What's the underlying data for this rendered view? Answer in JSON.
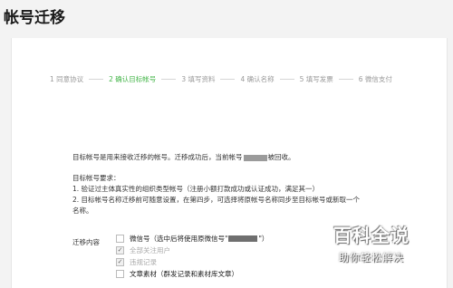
{
  "page_title": "帐号迁移",
  "steps": [
    {
      "label": "1 同意协议",
      "active": false
    },
    {
      "label": "2 确认目标帐号",
      "active": true
    },
    {
      "label": "3 填写资料",
      "active": false
    },
    {
      "label": "4 确认名称",
      "active": false
    },
    {
      "label": "5 填写发票",
      "active": false
    },
    {
      "label": "6 微信支付",
      "active": false
    }
  ],
  "intro": {
    "part1": "目标帐号是用来接收迁移的帐号。迁移成功后，当前帐号",
    "part2": "被回收。"
  },
  "requirements": {
    "title": "目标帐号要求：",
    "item1": "1. 验证过主体真实性的组织类型帐号（注册小额打款成功或认证成功，满足其一）",
    "item2": "2. 目标帐号名称迁移前可随意设置，在第四步，可选择将原帐号名称同步至目标帐号或新取一个",
    "item2_cont": "名称。"
  },
  "form": {
    "label": "迁移内容",
    "options": [
      {
        "prefix": "微信号（选中后将使用原微信号\"",
        "suffix": "\"）",
        "checked": false,
        "disabled": false
      },
      {
        "text": "全部关注用户",
        "checked": true,
        "disabled": true
      },
      {
        "text": "违规记录",
        "checked": true,
        "disabled": true
      },
      {
        "text": "文章素材（群发记录和素材库文章）",
        "checked": false,
        "disabled": false
      }
    ]
  },
  "watermark": {
    "title": "百科全说",
    "subtitle": "助你轻松解决"
  }
}
